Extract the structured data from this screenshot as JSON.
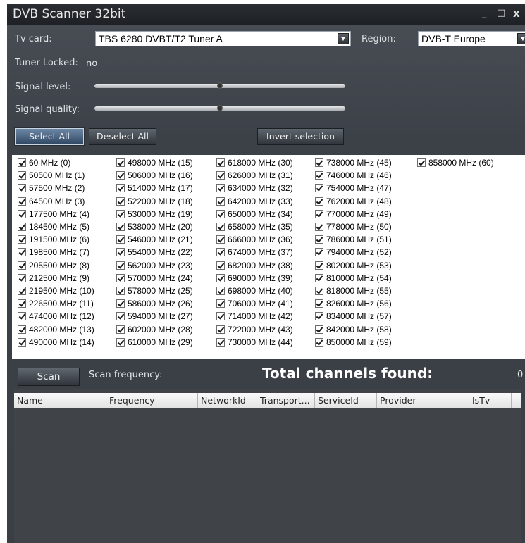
{
  "window": {
    "title": "DVB Scanner 32bit",
    "controls": [
      "_",
      "□",
      "x"
    ]
  },
  "form": {
    "tv_card_label": "Tv card:",
    "tv_card_value": "TBS 6280 DVBT/T2 Tuner A",
    "region_label": "Region:",
    "region_value": "DVB-T Europe",
    "tuner_locked_label": "Tuner Locked:",
    "tuner_locked_value": "no",
    "signal_level_label": "Signal level:",
    "signal_level_value": 0.5,
    "signal_quality_label": "Signal quality:",
    "signal_quality_value": 0.5
  },
  "buttons": {
    "select_all": "Select All",
    "deselect_all": "Deselect All",
    "invert_selection": "Invert selection",
    "scan": "Scan"
  },
  "frequencies": [
    [
      "60 MHz (0)",
      "50500 MHz (1)",
      "57500 MHz (2)",
      "64500 MHz (3)",
      "177500 MHz (4)",
      "184500 MHz (5)",
      "191500 MHz (6)",
      "198500 MHz (7)",
      "205500 MHz (8)",
      "212500 MHz (9)",
      "219500 MHz (10)",
      "226500 MHz (11)",
      "474000 MHz (12)",
      "482000 MHz (13)",
      "490000 MHz (14)"
    ],
    [
      "498000 MHz (15)",
      "506000 MHz (16)",
      "514000 MHz (17)",
      "522000 MHz (18)",
      "530000 MHz (19)",
      "538000 MHz (20)",
      "546000 MHz (21)",
      "554000 MHz (22)",
      "562000 MHz (23)",
      "570000 MHz (24)",
      "578000 MHz (25)",
      "586000 MHz (26)",
      "594000 MHz (27)",
      "602000 MHz (28)",
      "610000 MHz (29)"
    ],
    [
      "618000 MHz (30)",
      "626000 MHz (31)",
      "634000 MHz (32)",
      "642000 MHz (33)",
      "650000 MHz (34)",
      "658000 MHz (35)",
      "666000 MHz (36)",
      "674000 MHz (37)",
      "682000 MHz (38)",
      "690000 MHz (39)",
      "698000 MHz (40)",
      "706000 MHz (41)",
      "714000 MHz (42)",
      "722000 MHz (43)",
      "730000 MHz (44)"
    ],
    [
      "738000 MHz (45)",
      "746000 MHz (46)",
      "754000 MHz (47)",
      "762000 MHz (48)",
      "770000 MHz (49)",
      "778000 MHz (50)",
      "786000 MHz (51)",
      "794000 MHz (52)",
      "802000 MHz (53)",
      "810000 MHz (54)",
      "818000 MHz (55)",
      "826000 MHz (56)",
      "834000 MHz (57)",
      "842000 MHz (58)",
      "850000 MHz (59)"
    ],
    [
      "858000 MHz (60)"
    ]
  ],
  "scan": {
    "frequency_label": "Scan frequency:",
    "total_label": "Total channels found:",
    "total_value": "0"
  },
  "grid": {
    "columns": [
      "Name",
      "Frequency",
      "NetworkId",
      "Transport...",
      "ServiceId",
      "Provider",
      "IsTv"
    ]
  }
}
